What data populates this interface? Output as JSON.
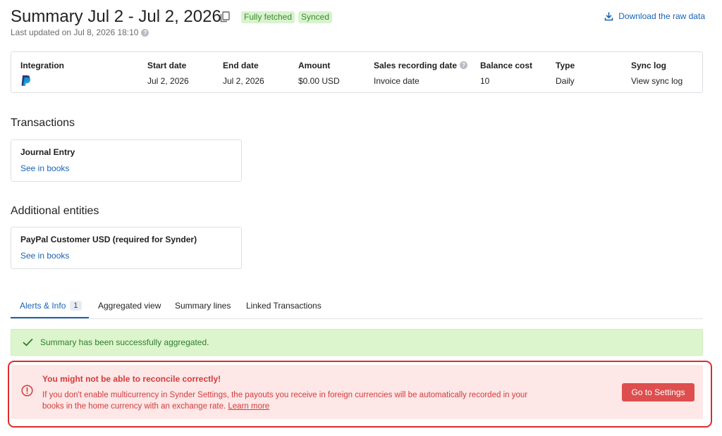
{
  "header": {
    "title": "Summary Jul 2 - Jul 2, 2026",
    "badges": [
      "Fully fetched",
      "Synced"
    ],
    "updated": "Last updated on Jul 8, 2026 18:10",
    "download_label": "Download the raw data"
  },
  "info": {
    "integration": {
      "label": "Integration",
      "logo": "paypal-logo"
    },
    "start_date": {
      "label": "Start date",
      "value": "Jul 2, 2026"
    },
    "end_date": {
      "label": "End date",
      "value": "Jul 2, 2026"
    },
    "amount": {
      "label": "Amount",
      "value": "$0.00 USD"
    },
    "sales_recording_date": {
      "label": "Sales recording date",
      "value": "Invoice date"
    },
    "balance_cost": {
      "label": "Balance cost",
      "value": "10"
    },
    "type": {
      "label": "Type",
      "value": "Daily"
    },
    "sync_log": {
      "label": "Sync log",
      "value": "View sync log"
    }
  },
  "transactions": {
    "title": "Transactions",
    "card": {
      "heading": "Journal Entry",
      "link": "See in books"
    }
  },
  "entities": {
    "title": "Additional entities",
    "card": {
      "heading": "PayPal Customer USD (required for Synder)",
      "link": "See in books"
    }
  },
  "tabs": [
    {
      "label": "Alerts & Info",
      "count": "1",
      "active": true
    },
    {
      "label": "Aggregated view"
    },
    {
      "label": "Summary lines"
    },
    {
      "label": "Linked Transactions"
    }
  ],
  "success": {
    "message": "Summary has been successfully aggregated."
  },
  "warning": {
    "title": "You might not be able to reconcile correctly!",
    "message": "If you don't enable multicurrency in Synder Settings, the payouts you receive in foreign currencies will be automatically recorded in your books in the home currency with an exchange rate.",
    "learn_more": "Learn more",
    "button": "Go to Settings"
  },
  "colors": {
    "link": "#1a63b5",
    "badge_bg": "#d8f3cf",
    "badge_text": "#3f8a2c",
    "success_bg": "#dcf5cc",
    "warning_bg": "#fde7e7",
    "warning_text": "#d33b3b",
    "warning_button": "#de4e4e",
    "highlight_outline": "#e02b2b"
  }
}
